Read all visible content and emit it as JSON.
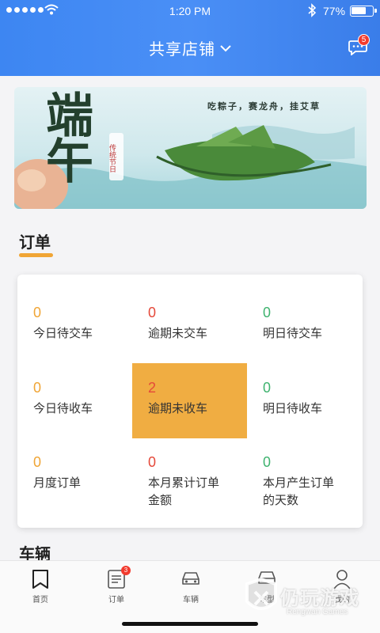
{
  "status_bar": {
    "time": "1:20 PM",
    "battery": "77%",
    "battery_level": 0.77
  },
  "header": {
    "store_title": "共享店铺",
    "message_count": "5"
  },
  "banner": {
    "title": "端午",
    "slogan": "吃粽子，赛龙舟，挂艾草"
  },
  "orders": {
    "title": "订单",
    "cells": [
      {
        "value": "0",
        "label": "今日待交车",
        "color": "#f0a535"
      },
      {
        "value": "0",
        "label": "逾期未交车",
        "color": "#e5493a"
      },
      {
        "value": "0",
        "label": "明日待交车",
        "color": "#3fb36f"
      },
      {
        "value": "0",
        "label": "今日待收车",
        "color": "#f0a535"
      },
      {
        "value": "2",
        "label": "逾期未收车",
        "color": "#e5493a"
      },
      {
        "value": "0",
        "label": "明日待收车",
        "color": "#3fb36f"
      },
      {
        "value": "0",
        "label": "月度订单",
        "color": "#f0a535"
      },
      {
        "value": "0",
        "label_line1": "本月累计订单",
        "label_line2": "金额",
        "color": "#e5493a"
      },
      {
        "value": "0",
        "label_line1": "本月产生订单",
        "label_line2": "的天数",
        "color": "#3fb36f"
      }
    ]
  },
  "vehicles": {
    "title": "车辆"
  },
  "tabbar": {
    "tabs": [
      {
        "label": "首页",
        "icon": "bookmark-icon"
      },
      {
        "label": "订单",
        "icon": "document-icon",
        "badge": "3"
      },
      {
        "label": "车辆",
        "icon": "car-icon"
      },
      {
        "label": "车型",
        "icon": "car-front-icon"
      },
      {
        "label": "我的",
        "icon": "user-icon"
      }
    ]
  },
  "watermark": {
    "text": "仍玩游戏",
    "sub": "Rengwan Games"
  },
  "colors": {
    "accent": "#3d86f2",
    "highlight": "#f0ad42"
  }
}
